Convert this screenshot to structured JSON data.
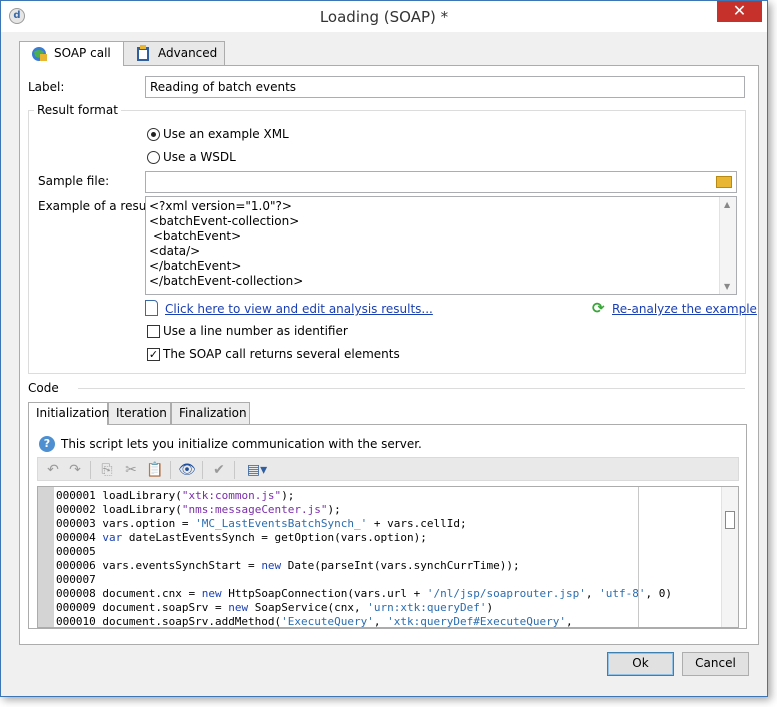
{
  "window": {
    "title": "Loading (SOAP) *",
    "close_glyph": "✕",
    "app_icon_glyph": "d"
  },
  "tabs": [
    {
      "label": "SOAP call",
      "active": true,
      "icon": "globe-icon"
    },
    {
      "label": "Advanced",
      "active": false,
      "icon": "clipboard-icon"
    }
  ],
  "form": {
    "label_caption": "Label:",
    "label_value": "Reading of batch events",
    "result_format_title": "Result format",
    "radio_xml_label": "Use an example XML",
    "radio_wsdl_label": "Use a WSDL",
    "sample_file_caption": "Sample file:",
    "sample_file_value": "",
    "example_caption": "Example of a result:",
    "example_lines": [
      "<?xml version=\"1.0\"?>",
      "<batchEvent-collection>",
      " <batchEvent>",
      "<data/>",
      "</batchEvent>",
      "</batchEvent-collection>"
    ],
    "view_edit_link": "Click here to view and edit analysis results...",
    "reanalyze_link": "Re-analyze the example",
    "line_number_label": "Use a line number as identifier",
    "line_number_checked": false,
    "several_elements_label": "The SOAP call returns several elements",
    "several_elements_checked": true,
    "check_glyph": "✓"
  },
  "code": {
    "section_title": "Code",
    "subtabs": [
      {
        "label": "Initialization",
        "active": true
      },
      {
        "label": "Iteration",
        "active": false
      },
      {
        "label": "Finalization",
        "active": false
      }
    ],
    "help_glyph": "?",
    "help_text": "This script lets you initialize communication with the server.",
    "toolbar": {
      "undo": "↶",
      "redo": "↷",
      "copy": "⎘",
      "cut": "✂",
      "paste": "📋",
      "find": "👁",
      "validate": "✔",
      "insert": "▤▾"
    },
    "lines": [
      {
        "n": "000001",
        "parts": [
          [
            "",
            "loadLibrary("
          ],
          [
            "str",
            "\"xtk:common.js\""
          ],
          [
            "",
            ");"
          ]
        ]
      },
      {
        "n": "000002",
        "parts": [
          [
            "",
            "loadLibrary("
          ],
          [
            "str",
            "\"nms:messageCenter.js\""
          ],
          [
            "",
            ");"
          ]
        ]
      },
      {
        "n": "000003",
        "parts": [
          [
            "",
            "vars.option = "
          ],
          [
            "str2",
            "'MC_LastEventsBatchSynch_'"
          ],
          [
            "",
            " + vars.cellId;"
          ]
        ]
      },
      {
        "n": "000004",
        "parts": [
          [
            "kw",
            "var"
          ],
          [
            "",
            " dateLastEventsSynch = getOption(vars.option);"
          ]
        ]
      },
      {
        "n": "000005",
        "parts": [
          [
            "",
            ""
          ]
        ]
      },
      {
        "n": "000006",
        "parts": [
          [
            "",
            "vars.eventsSynchStart = "
          ],
          [
            "kw",
            "new"
          ],
          [
            "",
            " Date(parseInt(vars.synchCurrTime));"
          ]
        ]
      },
      {
        "n": "000007",
        "parts": [
          [
            "",
            ""
          ]
        ]
      },
      {
        "n": "000008",
        "parts": [
          [
            "",
            "document.cnx = "
          ],
          [
            "kw",
            "new"
          ],
          [
            "",
            " HttpSoapConnection(vars.url + "
          ],
          [
            "str2",
            "'/nl/jsp/soaprouter.jsp'"
          ],
          [
            "",
            ", "
          ],
          [
            "str2",
            "'utf-8'"
          ],
          [
            "",
            ", 0)"
          ]
        ]
      },
      {
        "n": "000009",
        "parts": [
          [
            "",
            "document.soapSrv = "
          ],
          [
            "kw",
            "new"
          ],
          [
            "",
            " SoapService(cnx, "
          ],
          [
            "str2",
            "'urn:xtk:queryDef'"
          ],
          [
            "",
            ")"
          ]
        ]
      },
      {
        "n": "000010",
        "parts": [
          [
            "",
            "document.soapSrv.addMethod("
          ],
          [
            "str2",
            "'ExecuteQuery'"
          ],
          [
            "",
            ", "
          ],
          [
            "str2",
            "'xtk:queryDef#ExecuteQuery'"
          ],
          [
            "",
            ","
          ]
        ]
      }
    ]
  },
  "buttons": {
    "ok": "Ok",
    "cancel": "Cancel"
  }
}
